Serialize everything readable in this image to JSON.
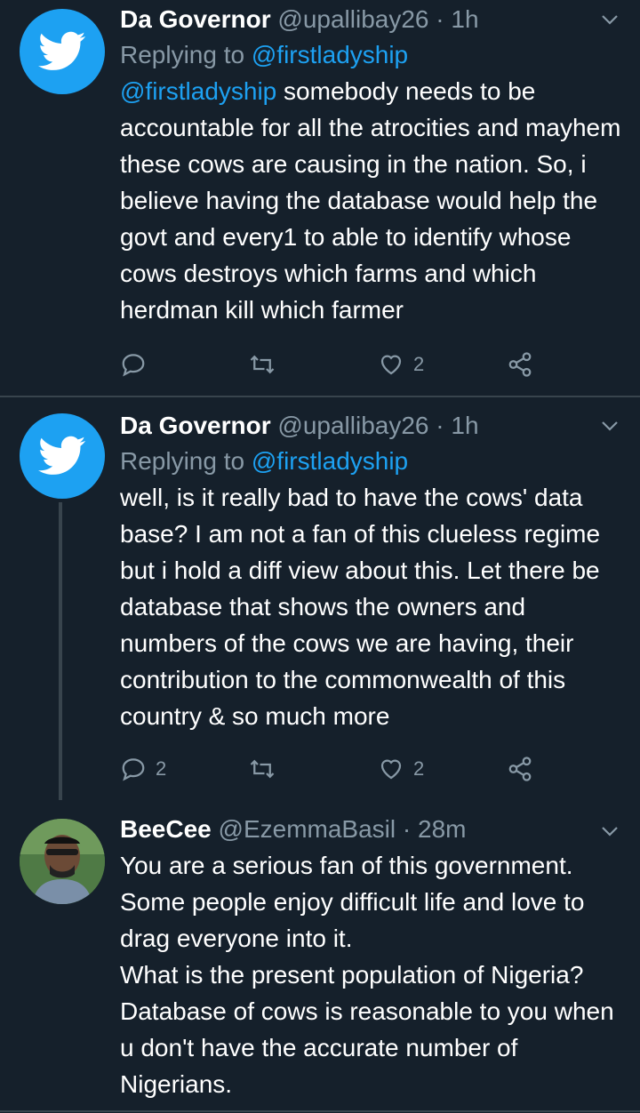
{
  "tweets": [
    {
      "name": "Da Governor",
      "handle": "@upallibay26",
      "dot": "·",
      "time": "1h",
      "replying_prefix": "Replying to",
      "replying_to": "@firstladyship",
      "mention": "@firstladyship",
      "text": " somebody needs to be accountable for all the atrocities and mayhem these cows are causing in the nation. So, i believe having the database would help the govt and every1 to able to identify whose cows destroys which farms and which herdman kill which farmer",
      "reply_count": "",
      "like_count": "2"
    },
    {
      "name": "Da Governor",
      "handle": "@upallibay26",
      "dot": "·",
      "time": "1h",
      "replying_prefix": "Replying to",
      "replying_to": "@firstladyship",
      "text": "well, is it really bad to have the cows' data base? I am not a fan of this clueless regime but i hold a diff view about this. Let there be database that shows the owners and numbers of the cows we are having, their contribution to the commonwealth of this country & so much more",
      "reply_count": "2",
      "like_count": "2"
    },
    {
      "name": "BeeCee",
      "handle": "@EzemmaBasil",
      "dot": "·",
      "time": "28m",
      "text": "You are a serious fan of this government. Some people enjoy difficult life and love to drag everyone into it.\nWhat is the present population of Nigeria? Database of cows is reasonable to you when u don't have the accurate number of Nigerians."
    }
  ],
  "colors": {
    "background": "#15202b",
    "accent": "#1da1f2",
    "muted": "#8899a6",
    "divider": "#38444d"
  },
  "icons": [
    "twitter-bird-icon",
    "chevron-down-icon",
    "reply-icon",
    "retweet-icon",
    "heart-icon",
    "share-icon"
  ]
}
